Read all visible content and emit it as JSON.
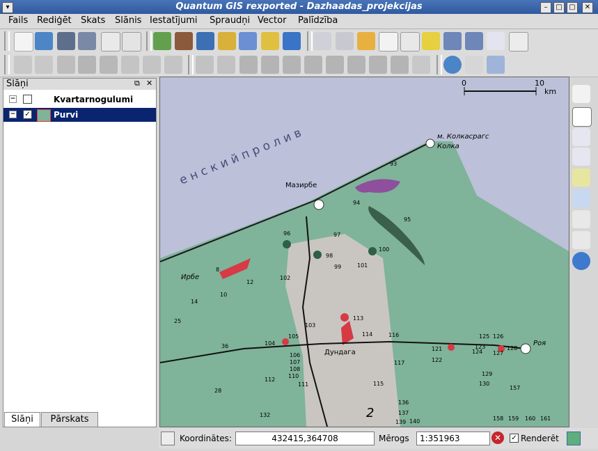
{
  "window": {
    "title": "Quantum GIS rexported - Dazhaadas_projekcijas"
  },
  "menu": [
    "Fails",
    "Rediģēt",
    "Skats",
    "Slānis",
    "Iestatījumi",
    "Spraudņi",
    "Vector",
    "Palīdzība"
  ],
  "layers_panel": {
    "title": "Slāņi",
    "layers": [
      {
        "name": "Kvartarnogulumi",
        "checked": false,
        "selected": false
      },
      {
        "name": "Purvi",
        "checked": true,
        "selected": true
      }
    ],
    "tabs": [
      "Slāņi",
      "Pārskats"
    ]
  },
  "map": {
    "scalebar": {
      "start": "0",
      "end": "10",
      "unit": "km"
    },
    "labels": [
      "е н с к и й   п р о л и в",
      "м. Колкасрагс",
      "Колка",
      "Мазирбе",
      "Ирбе",
      "Дундага",
      "Роя",
      "2"
    ],
    "numbers": [
      "93",
      "94",
      "95",
      "96",
      "97",
      "98",
      "99",
      "100",
      "101",
      "102",
      "103",
      "104",
      "105",
      "106",
      "107",
      "108",
      "110",
      "111",
      "112",
      "113",
      "114",
      "115",
      "116",
      "117",
      "121",
      "122",
      "123",
      "124",
      "125",
      "126",
      "127",
      "128",
      "129",
      "130",
      "132",
      "136",
      "137",
      "139",
      "140",
      "157",
      "159",
      "158",
      "160",
      "161",
      "8",
      "10",
      "12",
      "14",
      "25",
      "28",
      "36"
    ]
  },
  "statusbar": {
    "coords_label": "Koordinātes:",
    "coords_value": "432415,364708",
    "scale_label": "Mērogs",
    "scale_value": "1:351963",
    "render_label": "Renderēt",
    "render_checked": true
  },
  "colors": {
    "water": "#b9bfd6",
    "land": "#7fb39a",
    "marsh": "#8e4f9d",
    "red": "#d63a45"
  }
}
